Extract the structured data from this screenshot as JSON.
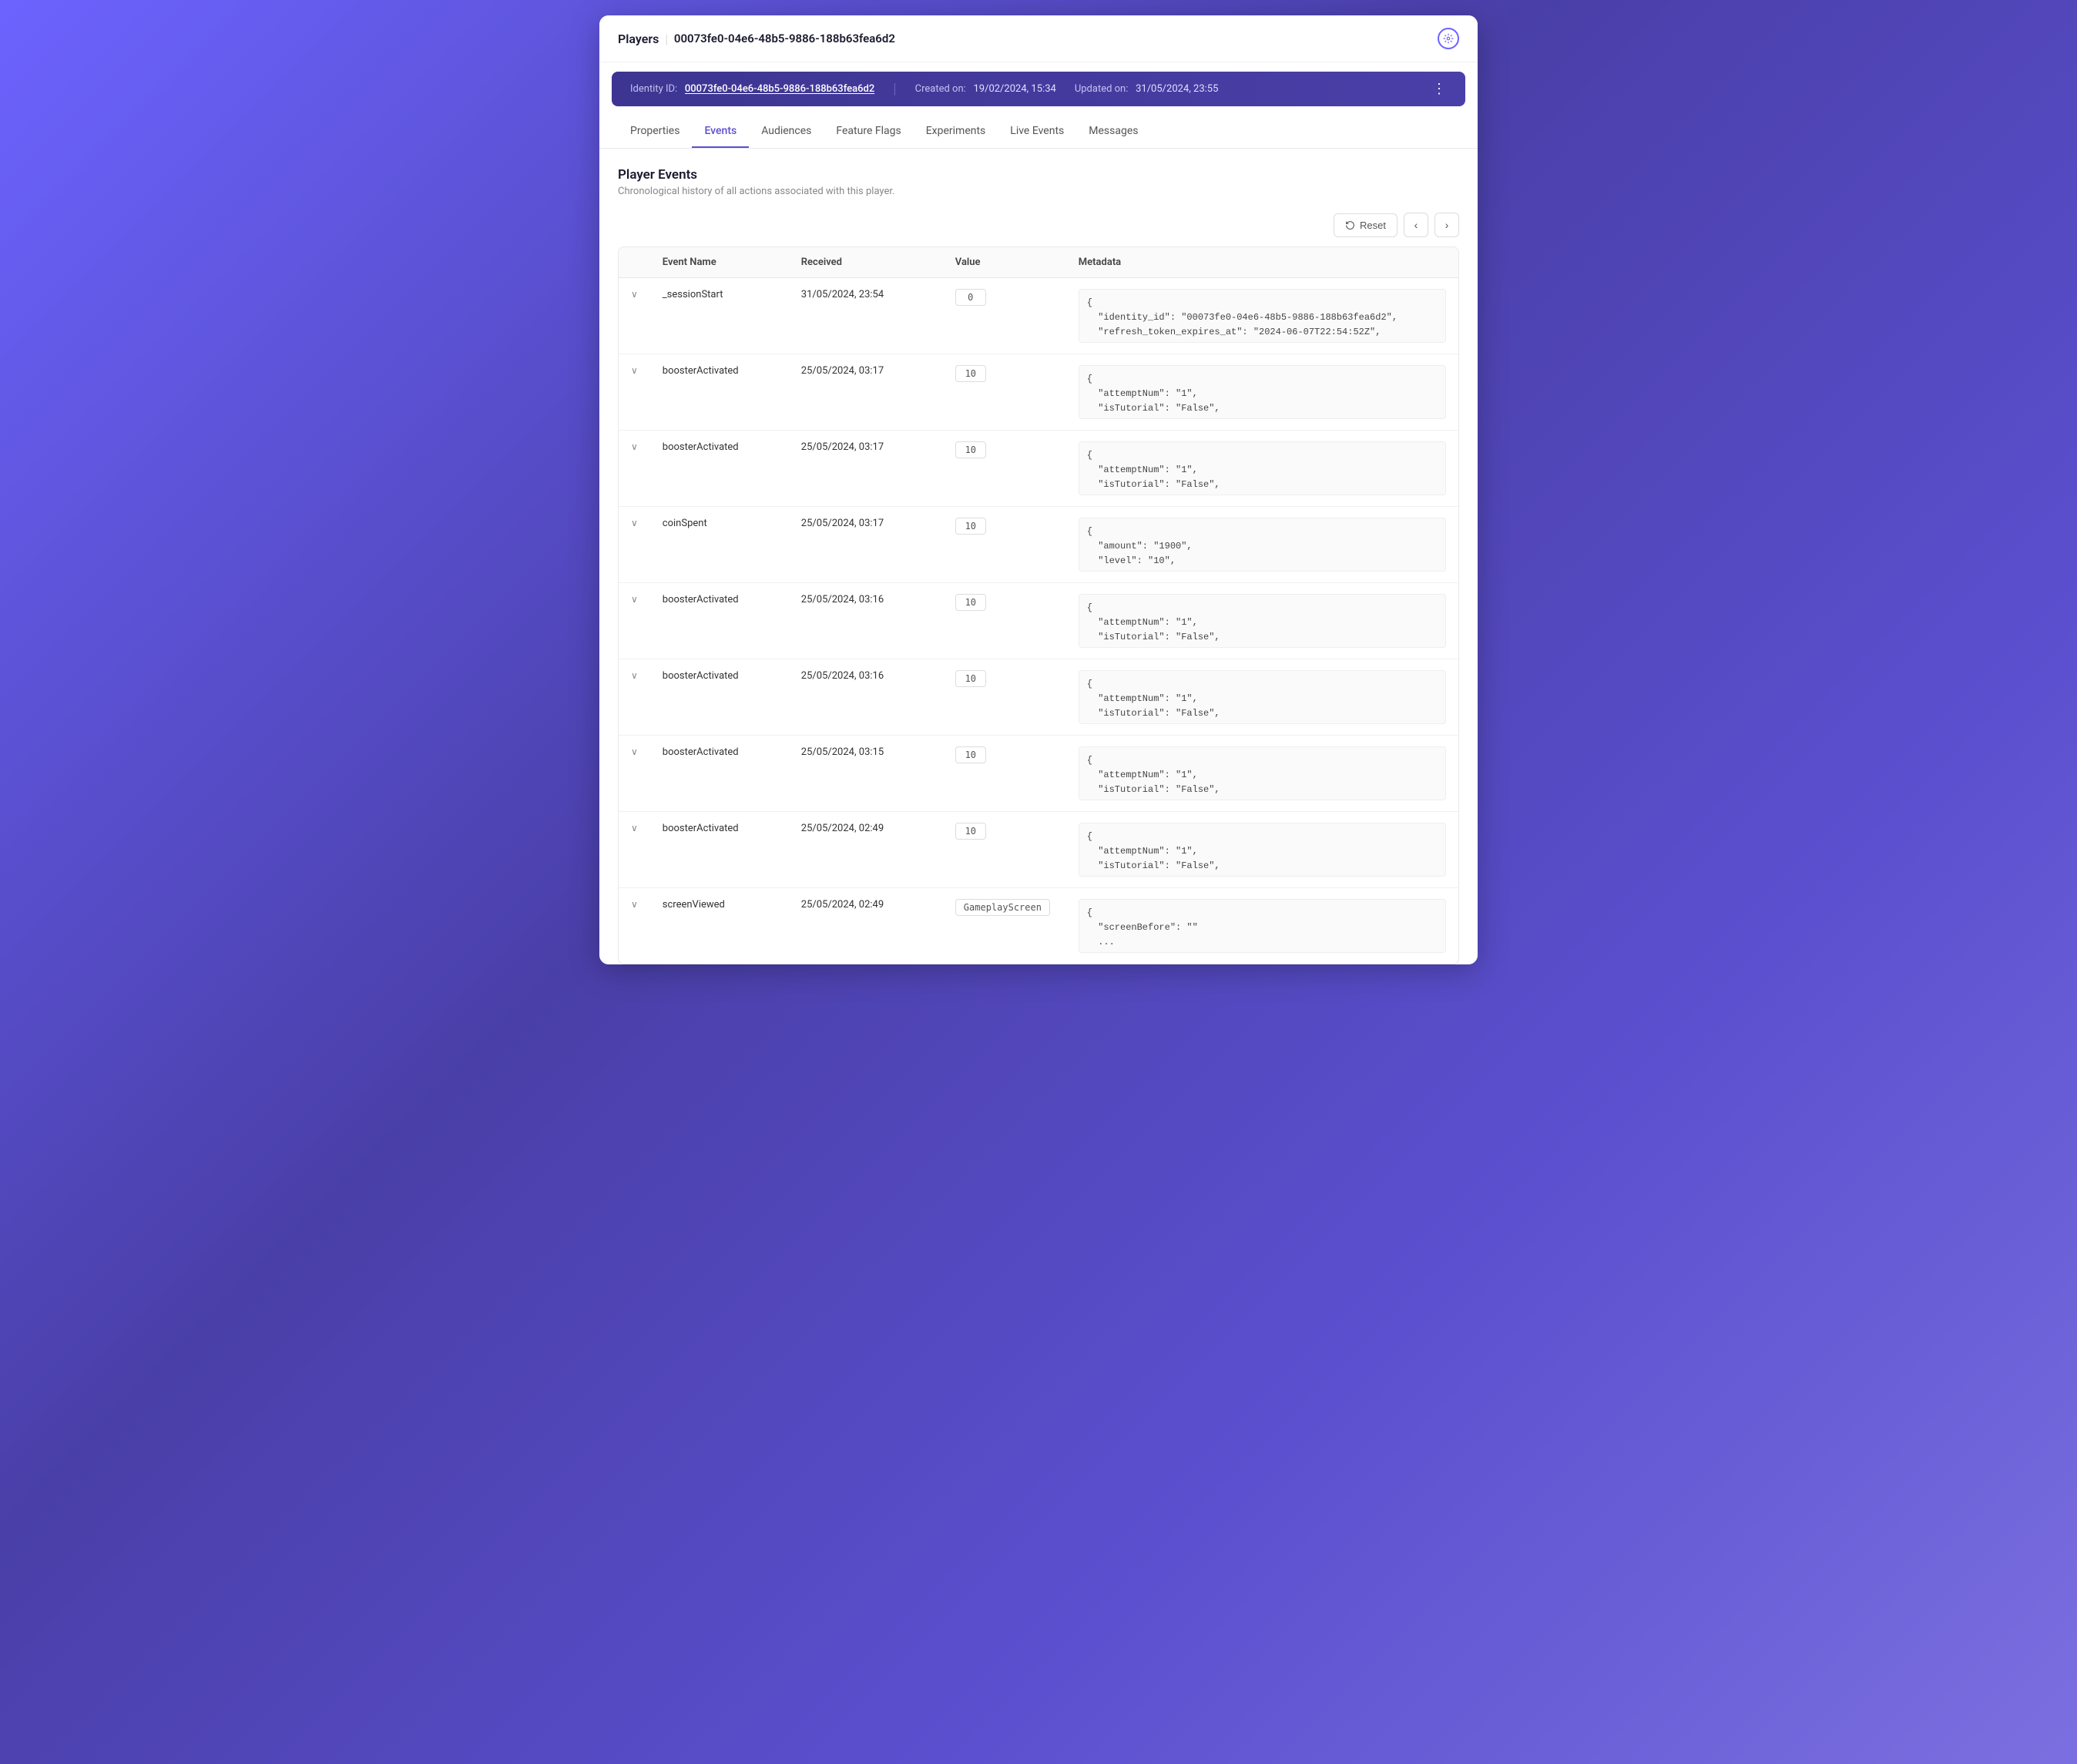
{
  "app": {
    "title": "Players",
    "separator": "|",
    "player_id": "00073fe0-04e6-48b5-9886-188b63fea6d2"
  },
  "identity_bar": {
    "identity_label": "Identity ID:",
    "identity_value": "00073fe0-04e6-48b5-9886-188b63fea6d2",
    "created_label": "Created on:",
    "created_value": "19/02/2024, 15:34",
    "updated_label": "Updated on:",
    "updated_value": "31/05/2024, 23:55",
    "more_icon": "⋮"
  },
  "tabs": [
    {
      "id": "properties",
      "label": "Properties",
      "active": false
    },
    {
      "id": "events",
      "label": "Events",
      "active": true
    },
    {
      "id": "audiences",
      "label": "Audiences",
      "active": false
    },
    {
      "id": "feature-flags",
      "label": "Feature Flags",
      "active": false
    },
    {
      "id": "experiments",
      "label": "Experiments",
      "active": false
    },
    {
      "id": "live-events",
      "label": "Live Events",
      "active": false
    },
    {
      "id": "messages",
      "label": "Messages",
      "active": false
    }
  ],
  "section": {
    "title": "Player Events",
    "description": "Chronological history of all actions associated with this player."
  },
  "toolbar": {
    "reset_label": "Reset",
    "prev_icon": "‹",
    "next_icon": "›"
  },
  "table": {
    "columns": [
      "",
      "Event Name",
      "Received",
      "Value",
      "Metadata"
    ],
    "rows": [
      {
        "expand": "∨",
        "event_name": "_sessionStart",
        "received": "31/05/2024, 23:54",
        "value": "0",
        "metadata": "{\n  \"identity_id\": \"00073fe0-04e6-48b5-9886-188b63fea6d2\",\n  \"refresh_token_expires_at\": \"2024-06-07T22:54:52Z\",\n  ..."
      },
      {
        "expand": "∨",
        "event_name": "boosterActivated",
        "received": "25/05/2024, 03:17",
        "value": "10",
        "metadata": "{\n  \"attemptNum\": \"1\",\n  \"isTutorial\": \"False\",\n  ..."
      },
      {
        "expand": "∨",
        "event_name": "boosterActivated",
        "received": "25/05/2024, 03:17",
        "value": "10",
        "metadata": "{\n  \"attemptNum\": \"1\",\n  \"isTutorial\": \"False\",\n  ..."
      },
      {
        "expand": "∨",
        "event_name": "coinSpent",
        "received": "25/05/2024, 03:17",
        "value": "10",
        "metadata": "{\n  \"amount\": \"1900\",\n  \"level\": \"10\",\n  ..."
      },
      {
        "expand": "∨",
        "event_name": "boosterActivated",
        "received": "25/05/2024, 03:16",
        "value": "10",
        "metadata": "{\n  \"attemptNum\": \"1\",\n  \"isTutorial\": \"False\",\n  ..."
      },
      {
        "expand": "∨",
        "event_name": "boosterActivated",
        "received": "25/05/2024, 03:16",
        "value": "10",
        "metadata": "{\n  \"attemptNum\": \"1\",\n  \"isTutorial\": \"False\",\n  ..."
      },
      {
        "expand": "∨",
        "event_name": "boosterActivated",
        "received": "25/05/2024, 03:15",
        "value": "10",
        "metadata": "{\n  \"attemptNum\": \"1\",\n  \"isTutorial\": \"False\",\n  ..."
      },
      {
        "expand": "∨",
        "event_name": "boosterActivated",
        "received": "25/05/2024, 02:49",
        "value": "10",
        "metadata": "{\n  \"attemptNum\": \"1\",\n  \"isTutorial\": \"False\",\n  ..."
      },
      {
        "expand": "∨",
        "event_name": "screenViewed",
        "received": "25/05/2024, 02:49",
        "value": "GameplayScreen",
        "metadata": "{\n  \"screenBefore\": \"\"\n  ..."
      }
    ]
  }
}
